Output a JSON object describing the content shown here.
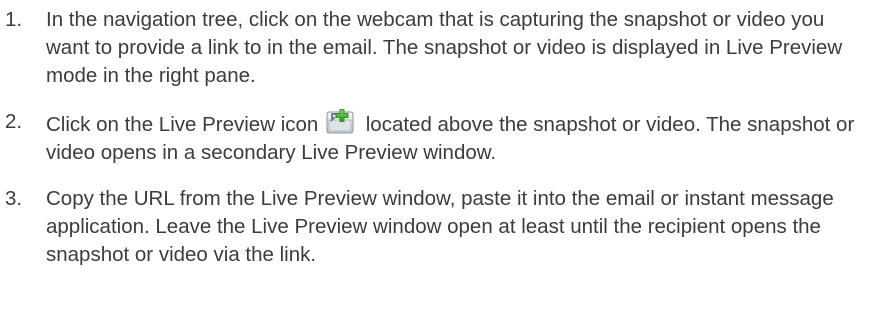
{
  "steps": [
    {
      "number": "1.",
      "text": "In the navigation tree, click on the webcam that is capturing the snapshot or video you want to provide a link to in the email. The snapshot or video is displayed in Live Preview mode in the right pane."
    },
    {
      "number": "2.",
      "text_before": "Click on the Live Preview icon",
      "icon": "live-preview-add-icon",
      "text_after": "located above the snapshot or video. The snapshot or video opens in a secondary Live Preview window."
    },
    {
      "number": "3.",
      "text": "Copy the URL from the Live Preview window, paste it into the email or instant message application. Leave the Live Preview window open at least until the recipient opens the snapshot or video via the link."
    }
  ]
}
